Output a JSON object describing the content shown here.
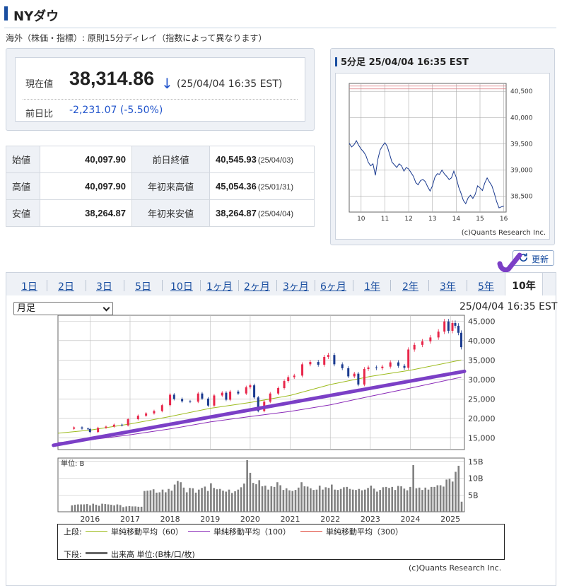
{
  "page": {
    "title": "NYダウ",
    "subtitle": "海外（株価・指標）: 原則15分ディレイ（指数によって異なります）"
  },
  "colors": {
    "accent": "#1a4ea0",
    "down": "#2255cc",
    "candle_up": "#e8264a",
    "candle_down": "#1a3a8f",
    "ma60": "#9dbb1e",
    "ma100": "#8a2bb8",
    "ma300": "#e0493a",
    "annotation": "#7b3fc6",
    "volume": "#808080"
  },
  "quote": {
    "current_label": "現在値",
    "current_value": "38,314.86",
    "direction_icon": "down-arrow-icon",
    "direction_glyph": "↓",
    "timestamp": "(25/04/04 16:35 EST)",
    "change_label": "前日比",
    "change_value": "-2,231.07",
    "change_pct": "(-5.50%)"
  },
  "stats": [
    {
      "label": "始値",
      "value": "40,097.90",
      "label2": "前日終値",
      "value2": "40,545.93",
      "date2": "(25/04/03)"
    },
    {
      "label": "高値",
      "value": "40,097.90",
      "label2": "年初来高値",
      "value2": "45,054.36",
      "date2": "(25/01/31)"
    },
    {
      "label": "安値",
      "value": "38,264.87",
      "label2": "年初来安値",
      "value2": "38,264.87",
      "date2": "(25/04/04)"
    }
  ],
  "intraday": {
    "header": "5分足 25/04/04 16:35 EST",
    "credit": "(c)Quants Research Inc."
  },
  "refresh_label": "更新",
  "tabs": [
    "1日",
    "2日",
    "3日",
    "5日",
    "10日",
    "1ヶ月",
    "2ヶ月",
    "3ヶ月",
    "6ヶ月",
    "1年",
    "2年",
    "3年",
    "5年",
    "10年"
  ],
  "active_tab": "10年",
  "chart_controls": {
    "period_select": "月足",
    "timestamp": "25/04/04 16:35 EST"
  },
  "legend": {
    "upper_label": "上段:",
    "lower_label": "下段:",
    "ma60": "単純移動平均（60）",
    "ma100": "単純移動平均（100）",
    "ma300": "単純移動平均（300）",
    "volume": "出来高 単位:(B株/口/枚)"
  },
  "main_credit": "(c)Quants Research Inc.",
  "chart_data": [
    {
      "type": "line",
      "xlabel": "",
      "ylabel": "",
      "x_ticks": [
        "10",
        "11",
        "12",
        "13",
        "14",
        "15",
        "16"
      ],
      "y_ticks": [
        38500,
        39000,
        39500,
        40000,
        40500
      ],
      "y_tick_labels": [
        "38,500",
        "39,000",
        "39,500",
        "40,000",
        "40,500"
      ],
      "ylim": [
        38200,
        40650
      ],
      "xlim": [
        9.5,
        16.1
      ],
      "reference_lines": [
        40545.93,
        40600
      ],
      "series": [
        {
          "x": [
            9.5,
            9.6,
            9.7,
            9.8,
            9.9,
            10.0,
            10.1,
            10.2,
            10.3,
            10.4,
            10.5,
            10.6,
            10.7,
            10.8,
            10.9,
            11.0,
            11.1,
            11.2,
            11.3,
            11.4,
            11.5,
            11.6,
            11.7,
            11.8,
            11.9,
            12.0,
            12.1,
            12.2,
            12.3,
            12.4,
            12.5,
            12.6,
            12.7,
            12.8,
            12.9,
            13.0,
            13.1,
            13.2,
            13.3,
            13.4,
            13.5,
            13.6,
            13.7,
            13.8,
            13.9,
            14.0,
            14.1,
            14.2,
            14.3,
            14.4,
            14.5,
            14.6,
            14.7,
            14.8,
            14.9,
            15.0,
            15.1,
            15.2,
            15.3,
            15.4,
            15.5,
            15.6,
            15.7,
            15.8,
            15.9,
            16.0
          ],
          "y": [
            39510,
            39440,
            39480,
            39560,
            39470,
            39400,
            39350,
            39280,
            39150,
            39080,
            39120,
            38900,
            39200,
            39380,
            39460,
            39520,
            39450,
            39300,
            39150,
            39100,
            39050,
            39120,
            39080,
            38980,
            39050,
            39020,
            38950,
            38880,
            38760,
            38720,
            38800,
            38820,
            38780,
            38680,
            38600,
            38700,
            38860,
            38930,
            38920,
            39000,
            38930,
            38880,
            38820,
            38850,
            38980,
            38860,
            38680,
            38560,
            38420,
            38360,
            38470,
            38520,
            38460,
            38540,
            38700,
            38660,
            38610,
            38750,
            38850,
            38770,
            38700,
            38560,
            38400,
            38280,
            38300,
            38315
          ]
        }
      ]
    },
    {
      "type": "candlestick",
      "title": "",
      "xlabel": "",
      "ylabel": "",
      "x_tick_labels": [
        "2016",
        "2017",
        "2018",
        "2019",
        "2020",
        "2021",
        "2022",
        "2023",
        "2024",
        "2025"
      ],
      "y_ticks": [
        15000,
        20000,
        25000,
        30000,
        35000,
        40000,
        45000
      ],
      "y_tick_labels": [
        "15,000",
        "20,000",
        "25,000",
        "30,000",
        "35,000",
        "40,000",
        "45,000"
      ],
      "ylim": [
        12000,
        46500
      ],
      "xlim": [
        2015.2,
        2025.35
      ],
      "closes": [
        {
          "t": 2015.6,
          "v": 17700
        },
        {
          "t": 2015.8,
          "v": 17400
        },
        {
          "t": 2015.95,
          "v": 17300
        },
        {
          "t": 2016.0,
          "v": 16500
        },
        {
          "t": 2016.2,
          "v": 17600
        },
        {
          "t": 2016.4,
          "v": 17900
        },
        {
          "t": 2016.6,
          "v": 18400
        },
        {
          "t": 2016.8,
          "v": 18200
        },
        {
          "t": 2016.95,
          "v": 19800
        },
        {
          "t": 2017.2,
          "v": 20700
        },
        {
          "t": 2017.4,
          "v": 21300
        },
        {
          "t": 2017.6,
          "v": 21900
        },
        {
          "t": 2017.8,
          "v": 23400
        },
        {
          "t": 2018.0,
          "v": 26100
        },
        {
          "t": 2018.1,
          "v": 25000
        },
        {
          "t": 2018.3,
          "v": 24400
        },
        {
          "t": 2018.5,
          "v": 24300
        },
        {
          "t": 2018.7,
          "v": 26400
        },
        {
          "t": 2018.8,
          "v": 25100
        },
        {
          "t": 2018.95,
          "v": 23300
        },
        {
          "t": 2019.1,
          "v": 25900
        },
        {
          "t": 2019.3,
          "v": 26600
        },
        {
          "t": 2019.4,
          "v": 24800
        },
        {
          "t": 2019.5,
          "v": 26900
        },
        {
          "t": 2019.7,
          "v": 26400
        },
        {
          "t": 2019.9,
          "v": 28000
        },
        {
          "t": 2020.0,
          "v": 28500
        },
        {
          "t": 2020.1,
          "v": 25400
        },
        {
          "t": 2020.2,
          "v": 21900
        },
        {
          "t": 2020.35,
          "v": 24300
        },
        {
          "t": 2020.5,
          "v": 26400
        },
        {
          "t": 2020.7,
          "v": 27800
        },
        {
          "t": 2020.85,
          "v": 29600
        },
        {
          "t": 2020.95,
          "v": 30600
        },
        {
          "t": 2021.1,
          "v": 31000
        },
        {
          "t": 2021.3,
          "v": 33900
        },
        {
          "t": 2021.5,
          "v": 34500
        },
        {
          "t": 2021.7,
          "v": 33800
        },
        {
          "t": 2021.85,
          "v": 35800
        },
        {
          "t": 2021.95,
          "v": 36300
        },
        {
          "t": 2022.1,
          "v": 33900
        },
        {
          "t": 2022.3,
          "v": 32900
        },
        {
          "t": 2022.45,
          "v": 30800
        },
        {
          "t": 2022.6,
          "v": 31500
        },
        {
          "t": 2022.7,
          "v": 28700
        },
        {
          "t": 2022.85,
          "v": 32700
        },
        {
          "t": 2022.95,
          "v": 33100
        },
        {
          "t": 2023.15,
          "v": 32900
        },
        {
          "t": 2023.3,
          "v": 33300
        },
        {
          "t": 2023.5,
          "v": 34400
        },
        {
          "t": 2023.7,
          "v": 33500
        },
        {
          "t": 2023.85,
          "v": 33000
        },
        {
          "t": 2023.95,
          "v": 37700
        },
        {
          "t": 2024.1,
          "v": 38900
        },
        {
          "t": 2024.3,
          "v": 39800
        },
        {
          "t": 2024.5,
          "v": 40800
        },
        {
          "t": 2024.7,
          "v": 42300
        },
        {
          "t": 2024.85,
          "v": 44900
        },
        {
          "t": 2024.95,
          "v": 42500
        },
        {
          "t": 2025.05,
          "v": 44500
        },
        {
          "t": 2025.12,
          "v": 43800
        },
        {
          "t": 2025.2,
          "v": 42000
        },
        {
          "t": 2025.27,
          "v": 38300
        }
      ],
      "ma60": [
        {
          "t": 2015.2,
          "v": 16200
        },
        {
          "t": 2016.0,
          "v": 17000
        },
        {
          "t": 2017.0,
          "v": 18600
        },
        {
          "t": 2018.0,
          "v": 20500
        },
        {
          "t": 2019.0,
          "v": 22600
        },
        {
          "t": 2020.0,
          "v": 24100
        },
        {
          "t": 2021.0,
          "v": 25900
        },
        {
          "t": 2022.0,
          "v": 28700
        },
        {
          "t": 2023.0,
          "v": 30800
        },
        {
          "t": 2024.0,
          "v": 32400
        },
        {
          "t": 2025.27,
          "v": 35000
        }
      ],
      "ma100": [
        {
          "t": 2015.2,
          "v": 13800
        },
        {
          "t": 2016.0,
          "v": 14500
        },
        {
          "t": 2017.0,
          "v": 15800
        },
        {
          "t": 2018.0,
          "v": 17300
        },
        {
          "t": 2019.0,
          "v": 19100
        },
        {
          "t": 2020.0,
          "v": 20500
        },
        {
          "t": 2021.0,
          "v": 21800
        },
        {
          "t": 2022.0,
          "v": 23500
        },
        {
          "t": 2023.0,
          "v": 25700
        },
        {
          "t": 2024.0,
          "v": 27800
        },
        {
          "t": 2025.27,
          "v": 30600
        }
      ],
      "trendline": [
        {
          "t": 2015.3,
          "v": 13100
        },
        {
          "t": 2025.35,
          "v": 32100
        }
      ]
    },
    {
      "type": "bar",
      "unit_label": "単位: B",
      "y_ticks": [
        5,
        10,
        15
      ],
      "y_tick_labels": [
        "5B",
        "10B",
        "15B"
      ],
      "ylim": [
        0,
        16
      ],
      "xlim": [
        2015.2,
        2025.35
      ],
      "values": [
        1.9,
        2.1,
        2.2,
        2.2,
        2.2,
        2.3,
        1.9,
        2.4,
        2.1,
        1.8,
        2.4,
        2.3,
        2.2,
        2.1,
        1.9,
        2.2,
        2.0,
        1.4,
        1.6,
        1.7,
        1.6,
        1.6,
        1.5,
        1.5,
        6.2,
        6.3,
        6.4,
        6.7,
        5.7,
        5.8,
        6.6,
        5.8,
        6.8,
        6.3,
        8.1,
        9.2,
        8.8,
        7.2,
        5.8,
        7.1,
        7.0,
        5.7,
        6.6,
        7.1,
        7.5,
        6.2,
        8.5,
        7.1,
        6.7,
        6.8,
        6.3,
        6.0,
        6.6,
        5.6,
        6.1,
        6.6,
        7.3,
        8.4,
        15.4,
        11.6,
        8.6,
        8.2,
        9.4,
        7.6,
        7.8,
        6.6,
        7.6,
        7.4,
        8.8,
        7.9,
        6.5,
        7.0,
        6.4,
        6.2,
        6.5,
        7.2,
        8.8,
        7.6,
        7.5,
        7.0,
        6.5,
        6.6,
        7.8,
        6.6,
        7.3,
        7.1,
        8.1,
        6.6,
        6.5,
        6.8,
        7.3,
        7.4,
        6.8,
        6.6,
        6.5,
        6.8,
        6.4,
        6.6,
        7.1,
        7.8,
        6.9,
        6.0,
        6.5,
        7.3,
        7.4,
        7.1,
        7.4,
        6.5,
        7.7,
        7.6,
        6.9,
        6.4,
        7.4,
        13.9,
        7.0,
        7.2,
        6.5,
        7.2,
        6.6,
        7.4,
        7.4,
        7.9,
        7.9,
        7.5,
        9.6,
        9.8,
        9.0,
        11.9,
        13.7,
        3.0
      ]
    }
  ]
}
